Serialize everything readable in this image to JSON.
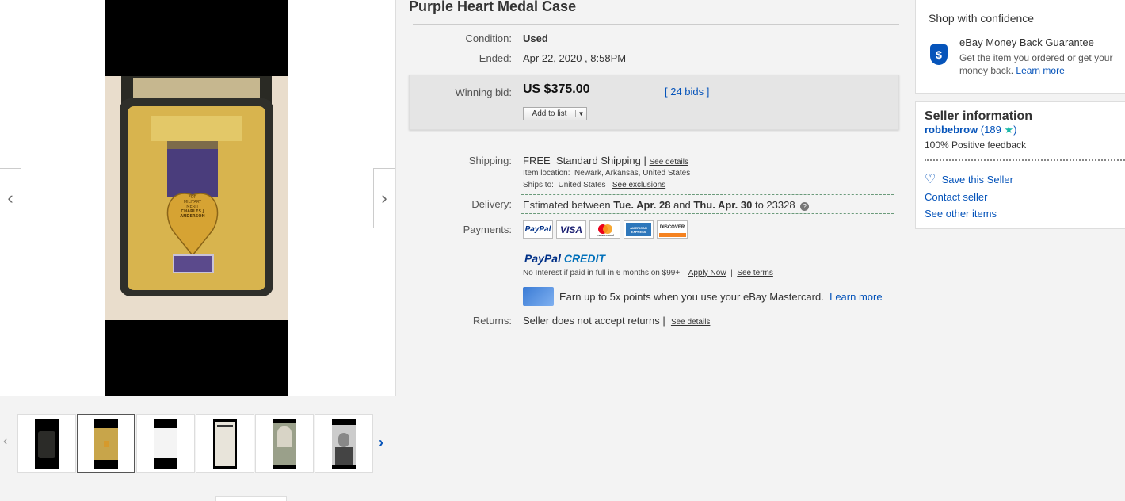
{
  "item": {
    "title": "Purple Heart Medal Case",
    "condition_label": "Condition:",
    "condition": "Used",
    "ended_label": "Ended:",
    "ended": "Apr 22, 2020 , 8:58PM"
  },
  "bid": {
    "label": "Winning bid:",
    "amount": "US $375.00",
    "bids": "[ 24 bids ]",
    "add_to_list": "Add to list"
  },
  "shipping": {
    "label": "Shipping:",
    "cost": "FREE",
    "method": "Standard Shipping |",
    "details_link": "See details",
    "location_label": "Item location:",
    "location": "Newark, Arkansas, United States",
    "ships_to_label": "Ships to:",
    "ships_to": "United States",
    "exclusions_link": "See exclusions"
  },
  "delivery": {
    "label": "Delivery:",
    "text_1": "Estimated between",
    "date_1": "Tue. Apr. 28",
    "text_2": "and",
    "date_2": "Thu. Apr. 30",
    "text_3": "to 23328"
  },
  "payments": {
    "label": "Payments:",
    "methods": [
      "PayPal",
      "VISA",
      "mastercard",
      "AMERICAN EXPRESS",
      "DISCOVER"
    ],
    "paypal_credit_1": "PayPal",
    "paypal_credit_2": "CREDIT",
    "promo": "No Interest if paid in full in 6 months on $99+.",
    "apply_now": "Apply Now",
    "sep": "|",
    "see_terms": "See terms",
    "mastercard_text": "Earn up to 5x points when you use your eBay Mastercard.",
    "mastercard_link": "Learn more"
  },
  "returns": {
    "label": "Returns:",
    "text": "Seller does not accept returns |",
    "details_link": "See details"
  },
  "confidence": {
    "title": "Shop with confidence",
    "guarantee_title": "eBay Money Back Guarantee",
    "guarantee_text": "Get the item you ordered or get your money back.",
    "learn_more": "Learn more"
  },
  "seller": {
    "title": "Seller information",
    "name": "robbebrow",
    "score": "(189",
    "score_end": ")",
    "feedback": "100% Positive feedback",
    "save": "Save this Seller",
    "contact": "Contact seller",
    "other": "See other items"
  },
  "medal": {
    "line1": "FOR",
    "line2": "MILITARY",
    "line3": "MERIT",
    "line4": "CHARLES J",
    "line5": "ANDERSON"
  },
  "colors": {
    "link": "#0654ba",
    "accent_star": "#1cb8a8",
    "paypal_dark": "#003087"
  }
}
